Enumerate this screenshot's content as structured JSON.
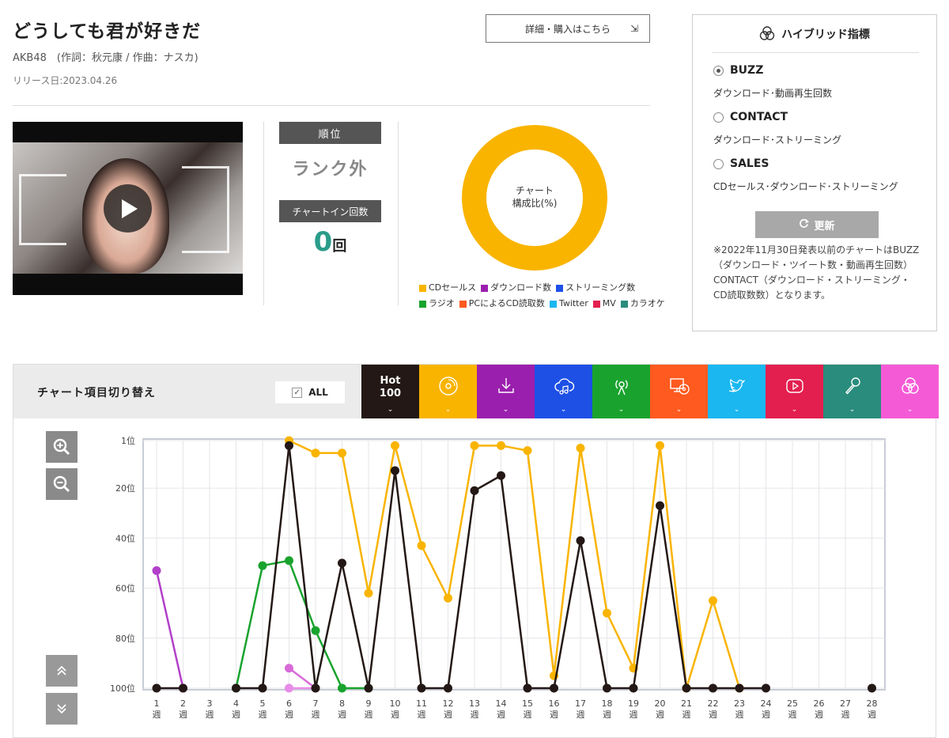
{
  "song": {
    "title": "どうしても君が好きだ",
    "credit": "AKB48　(作詞：秋元康 / 作曲：ナスカ)",
    "release": "リリース日:2023.04.26"
  },
  "buy_button": {
    "label": "詳細・購入はこちら",
    "arrow": "⇲"
  },
  "rank": {
    "header": "順位",
    "value": "ランク外"
  },
  "chart_in": {
    "header": "チャートイン回数",
    "value": "0",
    "unit": "回"
  },
  "donut": {
    "label_line1": "チャート",
    "label_line2": "構成比(%)",
    "legend": [
      {
        "label": "CDセールス",
        "color": "#f9b400"
      },
      {
        "label": "ダウンロード数",
        "color": "#9b1fae"
      },
      {
        "label": "ストリーミング数",
        "color": "#1e50e6"
      },
      {
        "label": "ラジオ",
        "color": "#19a32e"
      },
      {
        "label": "PCによるCD読取数",
        "color": "#ff5a1f"
      },
      {
        "label": "Twitter",
        "color": "#1ab7f0"
      },
      {
        "label": "MV",
        "color": "#e31f4f"
      },
      {
        "label": "カラオケ",
        "color": "#2a8c7c"
      }
    ]
  },
  "hybrid": {
    "title": "ハイブリッド指標",
    "options": [
      {
        "name": "BUZZ",
        "desc": "ダウンロード･動画再生回数",
        "selected": true
      },
      {
        "name": "CONTACT",
        "desc": "ダウンロード･ストリーミング",
        "selected": false
      },
      {
        "name": "SALES",
        "desc": "CDセールス･ダウンロード･ストリーミング",
        "selected": false
      }
    ],
    "refresh_label": "更新",
    "note": "※2022年11月30日発表以前のチャートはBUZZ（ダウンロード・ツイート数・動画再生回数）CONTACT（ダウンロード・ストリーミング・CD読取数数）となります。"
  },
  "switchbar": {
    "label": "チャート項目切り替え",
    "all_label": "ALL",
    "tabs": [
      {
        "name": "hot100",
        "text1": "Hot",
        "text2": "100",
        "color": "#231815"
      },
      {
        "name": "cd-sales",
        "icon": "cd-icon",
        "color": "#f9b400"
      },
      {
        "name": "download",
        "icon": "download-icon",
        "color": "#9b1fae"
      },
      {
        "name": "streaming",
        "icon": "cloud-music-icon",
        "color": "#1e50e6"
      },
      {
        "name": "radio",
        "icon": "radio-icon",
        "color": "#19a32e"
      },
      {
        "name": "pc-cd-read",
        "icon": "pc-cd-icon",
        "color": "#ff5a1f"
      },
      {
        "name": "twitter",
        "icon": "twitter-icon",
        "color": "#1ab7f0"
      },
      {
        "name": "mv",
        "icon": "youtube-icon",
        "color": "#e31f4f"
      },
      {
        "name": "karaoke",
        "icon": "microphone-icon",
        "color": "#2a8c7c"
      },
      {
        "name": "hybrid",
        "icon": "hybrid-icon",
        "color": "#f55ad6"
      }
    ]
  },
  "chart_data": {
    "type": "line",
    "y_inverted": true,
    "ylim": [
      1,
      100
    ],
    "ytick_values": [
      1,
      20,
      40,
      60,
      80,
      100
    ],
    "ytick_labels": [
      "1位",
      "20位",
      "40位",
      "60位",
      "80位",
      "100位"
    ],
    "x": [
      1,
      2,
      3,
      4,
      5,
      6,
      7,
      8,
      9,
      10,
      11,
      12,
      13,
      14,
      15,
      16,
      17,
      18,
      19,
      20,
      21,
      22,
      23,
      24,
      25,
      26,
      27,
      28
    ],
    "x_unit": "週",
    "grid": true,
    "series": [
      {
        "color": "#231815",
        "points": [
          [
            1,
            100
          ],
          [
            2,
            100
          ],
          [
            4,
            100
          ],
          [
            5,
            100
          ],
          [
            6,
            3
          ],
          [
            7,
            100
          ],
          [
            8,
            50
          ],
          [
            9,
            100
          ],
          [
            10,
            13
          ],
          [
            11,
            100
          ],
          [
            12,
            100
          ],
          [
            13,
            21
          ],
          [
            14,
            15
          ],
          [
            15,
            100
          ],
          [
            16,
            100
          ],
          [
            17,
            41
          ],
          [
            18,
            100
          ],
          [
            19,
            100
          ],
          [
            20,
            27
          ],
          [
            21,
            100
          ],
          [
            22,
            100
          ],
          [
            23,
            100
          ],
          [
            24,
            100
          ],
          [
            28,
            100
          ]
        ]
      },
      {
        "color": "#f9b400",
        "points": [
          [
            6,
            1
          ],
          [
            7,
            6
          ],
          [
            8,
            6
          ],
          [
            9,
            62
          ],
          [
            10,
            3
          ],
          [
            11,
            43
          ],
          [
            12,
            64
          ],
          [
            13,
            3
          ],
          [
            14,
            3
          ],
          [
            15,
            5
          ],
          [
            16,
            95
          ],
          [
            17,
            4
          ],
          [
            18,
            70
          ],
          [
            19,
            92
          ],
          [
            20,
            3
          ],
          [
            21,
            100
          ],
          [
            22,
            65
          ],
          [
            23,
            100
          ]
        ]
      },
      {
        "color": "#19a32e",
        "points": [
          [
            4,
            100
          ],
          [
            5,
            51
          ],
          [
            6,
            49
          ],
          [
            7,
            77
          ],
          [
            8,
            100
          ],
          [
            9,
            100
          ]
        ]
      },
      {
        "color": "#b23fc9",
        "points": [
          [
            1,
            53
          ],
          [
            2,
            100
          ]
        ]
      },
      {
        "color": "#d86ad8",
        "points": [
          [
            6,
            92
          ],
          [
            7,
            100
          ]
        ]
      },
      {
        "color": "#e98be9",
        "points": [
          [
            6,
            100
          ],
          [
            7,
            100
          ]
        ]
      }
    ]
  }
}
